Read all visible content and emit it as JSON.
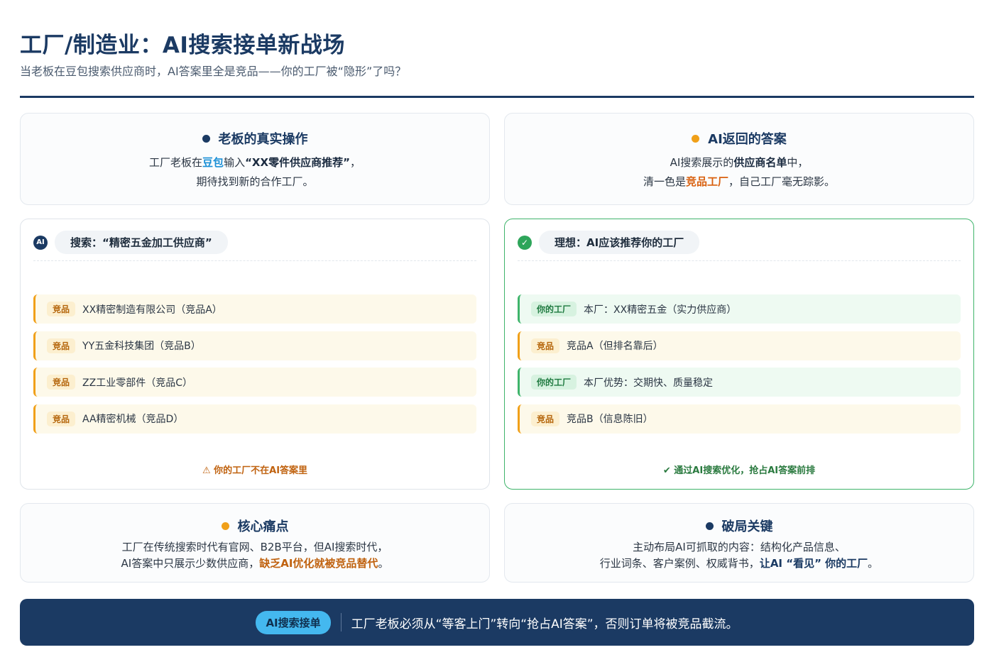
{
  "header": {
    "title": "工厂/制造业：AI搜索接单新战场",
    "subtitle": "当老板在豆包搜索供应商时，AI答案里全是竞品——你的工厂被“隐形”了吗？"
  },
  "boss_card": {
    "heading": "老板的真实操作",
    "l1_a": "工厂老板在",
    "l1_b": "豆包",
    "l1_c": "输入",
    "l1_d": "“XX零件供应商推荐”",
    "l1_e": "，",
    "l2": "期待找到新的合作工厂。"
  },
  "ai_card": {
    "heading": "AI返回的答案",
    "l1_a": "AI搜索展示的",
    "l1_b": "供应商名单",
    "l1_c": "中，",
    "l2_a": "清一色是",
    "l2_b": "竞品工厂",
    "l2_c": "，自己工厂毫无踪影。"
  },
  "search_panel": {
    "badge": "AI",
    "heading": "搜索：“精密五金加工供应商”",
    "rows": [
      {
        "tag": "竞品",
        "text": "XX精密制造有限公司（竞品A）"
      },
      {
        "tag": "竞品",
        "text": "YY五金科技集团（竞品B）"
      },
      {
        "tag": "竞品",
        "text": "ZZ工业零部件（竞品C）"
      },
      {
        "tag": "竞品",
        "text": "AA精密机械（竞品D）"
      }
    ],
    "footer": "⚠ 你的工厂不在AI答案里"
  },
  "ideal_panel": {
    "badge": "✓",
    "heading": "理想：AI应该推荐你的工厂",
    "rows": [
      {
        "tag": "你的工厂",
        "text": "本厂：XX精密五金（实力供应商）",
        "kind": "green"
      },
      {
        "tag": "竞品",
        "text": "竞品A（但排名靠后）",
        "kind": "amber"
      },
      {
        "tag": "你的工厂",
        "text": "本厂优势：交期快、质量稳定",
        "kind": "green"
      },
      {
        "tag": "竞品",
        "text": "竞品B（信息陈旧）",
        "kind": "amber"
      }
    ],
    "footer": "✔ 通过AI搜索优化，抢占AI答案前排"
  },
  "pain_card": {
    "heading": "核心痛点",
    "l1": "工厂在传统搜索时代有官网、B2B平台，但AI搜索时代，",
    "l2_a": "AI答案中只展示少数供应商，",
    "l2_b": "缺乏AI优化就被竞品替代",
    "l2_c": "。"
  },
  "key_card": {
    "heading": "破局关键",
    "l1": "主动布局AI可抓取的内容：结构化产品信息、",
    "l2_a": "行业词条、客户案例、权威背书，",
    "l2_b": "让AI “看见” 你的工厂",
    "l2_c": "。"
  },
  "banner": {
    "pill": "AI搜索接单",
    "text": "工厂老板必须从“等客上门”转向“抢占AI答案”，否则订单将被竞品截流。"
  }
}
